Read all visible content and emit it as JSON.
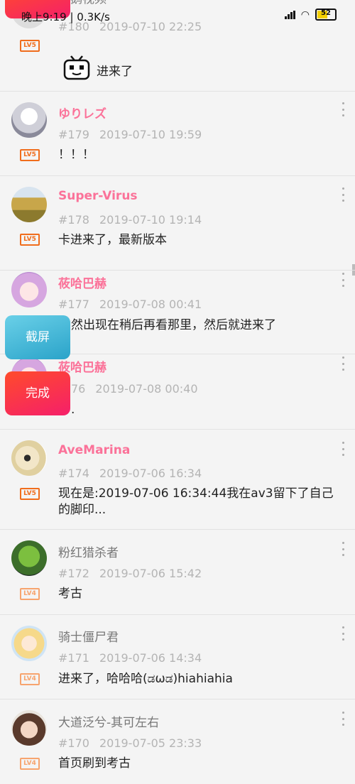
{
  "status": {
    "time_speed": "晚上9:19 | 0.3K/s",
    "battery": "52"
  },
  "float_buttons": {
    "screenshot": "截屏",
    "done": "完成"
  },
  "comments": [
    {
      "name": "企鹅视频",
      "no": "#180",
      "time": "2019-07-10 22:25",
      "level": "LV5",
      "text": "进来了",
      "sticker": "tv-emoji"
    },
    {
      "name": "ゆりレズ",
      "no": "#179",
      "time": "2019-07-10 19:59",
      "level": "LV5",
      "text": "！！！"
    },
    {
      "name": "Super-Virus",
      "no": "#178",
      "time": "2019-07-10 19:14",
      "level": "LV5",
      "text": "卡进来了，最新版本"
    },
    {
      "name": "莜哈巴赫",
      "no": "#177",
      "time": "2019-07-08 00:41",
      "level": "",
      "text": "然出现在稍后再看那里，然后就进来了"
    },
    {
      "name": "莜哈巴赫",
      "no": "76",
      "time": "2019-07-08 00:40",
      "level": "",
      "text": "."
    },
    {
      "name": "AveMarina",
      "no": "#174",
      "time": "2019-07-06 16:34",
      "level": "LV5",
      "text": "现在是:2019-07-06 16:34:44我在av3留下了自己的脚印..."
    },
    {
      "name": "粉红猎杀者",
      "no": "#172",
      "time": "2019-07-06 15:42",
      "level": "LV4",
      "text": "考古"
    },
    {
      "name": "骑士僵尸君",
      "no": "#171",
      "time": "2019-07-06 14:34",
      "level": "LV4",
      "text": "进来了，哈哈哈(ಡωಡ)hiahiahia"
    },
    {
      "name": "大道泛兮-其可左右",
      "no": "#170",
      "time": "2019-07-05 23:33",
      "level": "LV4",
      "text": "首页刷到考古"
    }
  ]
}
